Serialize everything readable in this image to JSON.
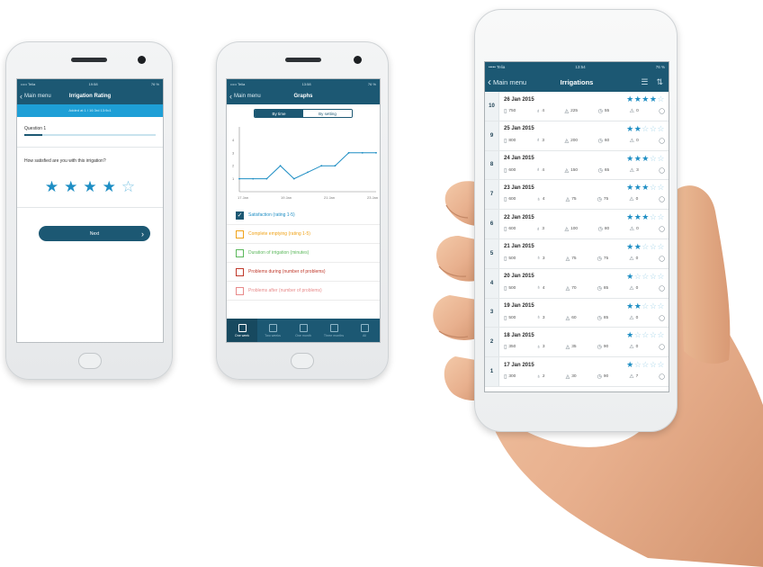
{
  "phone1": {
    "status": {
      "carrier": "••••• Telia",
      "time": "19:58",
      "battery": "76 %"
    },
    "nav": {
      "back": "Main menu",
      "title": "Irrigation Rating"
    },
    "subheader": "Added at 1 / 16 3rd 13:9c1",
    "question_label": "Question 1",
    "progress": 0.14,
    "prompt": "How satisfied are you with this irrigation?",
    "rating": 4,
    "rating_max": 5,
    "next_label": "Next"
  },
  "phone2": {
    "status": {
      "carrier": "••••• Telia",
      "time": "13:58",
      "battery": "76 %"
    },
    "nav": {
      "back": "Main menu",
      "title": "Graphs"
    },
    "segments": [
      "By time",
      "By setting"
    ],
    "active_segment": 0,
    "chart_data": {
      "type": "line",
      "x": [
        "17 Jan",
        "19 Jan",
        "21 Jan",
        "23 Jan"
      ],
      "ylim": [
        0,
        5
      ],
      "yticks": [
        "4",
        "3",
        "2",
        "1"
      ],
      "series": [
        {
          "name": "Satisfaction (rating 1-5)",
          "values": [
            1,
            1,
            1,
            2,
            1,
            1.5,
            2,
            2,
            3,
            3,
            3
          ]
        }
      ],
      "grid": false
    },
    "legend": [
      {
        "label": "Satisfaction (rating 1-5)",
        "color": "#1e8ec4",
        "checked": true
      },
      {
        "label": "Complete emptying (rating 1-5)",
        "color": "#f0a31a",
        "checked": false
      },
      {
        "label": "Duration of irrigation (minutes)",
        "color": "#5cb85c",
        "checked": false
      },
      {
        "label": "Problems during (number of problems)",
        "color": "#c0392b",
        "checked": false
      },
      {
        "label": "Problems after (number of problems)",
        "color": "#e88a8a",
        "checked": false
      }
    ],
    "tabs": [
      {
        "label": "One week",
        "active": true
      },
      {
        "label": "Two weeks",
        "active": false
      },
      {
        "label": "One month",
        "active": false
      },
      {
        "label": "Three months",
        "active": false
      },
      {
        "label": "All",
        "active": false
      }
    ]
  },
  "phone3": {
    "status": {
      "carrier": "••••• Telia",
      "time": "13:54",
      "battery": "76 %"
    },
    "nav": {
      "back": "Main menu",
      "title": "Irrigations"
    },
    "rows": [
      {
        "num": "10",
        "date": "26 Jan 2015",
        "stars": 4,
        "volume": "750",
        "a": "4",
        "b": "225",
        "c": "55",
        "d": "0"
      },
      {
        "num": "9",
        "date": "25 Jan 2015",
        "stars": 2,
        "volume": "800",
        "a": "3",
        "b": "200",
        "c": "60",
        "d": "0"
      },
      {
        "num": "8",
        "date": "24 Jan 2015",
        "stars": 3,
        "volume": "600",
        "a": "4",
        "b": "150",
        "c": "65",
        "d": "3"
      },
      {
        "num": "7",
        "date": "23 Jan 2015",
        "stars": 3,
        "volume": "600",
        "a": "4",
        "b": "75",
        "c": "75",
        "d": "0"
      },
      {
        "num": "6",
        "date": "22 Jan 2015",
        "stars": 3,
        "volume": "600",
        "a": "3",
        "b": "100",
        "c": "80",
        "d": "0"
      },
      {
        "num": "5",
        "date": "21 Jan 2015",
        "stars": 2,
        "volume": "500",
        "a": "3",
        "b": "75",
        "c": "75",
        "d": "0"
      },
      {
        "num": "4",
        "date": "20 Jan 2015",
        "stars": 1,
        "volume": "500",
        "a": "4",
        "b": "70",
        "c": "85",
        "d": "0"
      },
      {
        "num": "3",
        "date": "19 Jan 2015",
        "stars": 2,
        "volume": "500",
        "a": "3",
        "b": "60",
        "c": "85",
        "d": "0"
      },
      {
        "num": "2",
        "date": "18 Jan 2015",
        "stars": 1,
        "volume": "350",
        "a": "3",
        "b": "35",
        "c": "90",
        "d": "0"
      },
      {
        "num": "1",
        "date": "17 Jan 2015",
        "stars": 1,
        "volume": "300",
        "a": "2",
        "b": "30",
        "c": "90",
        "d": "7"
      }
    ]
  }
}
